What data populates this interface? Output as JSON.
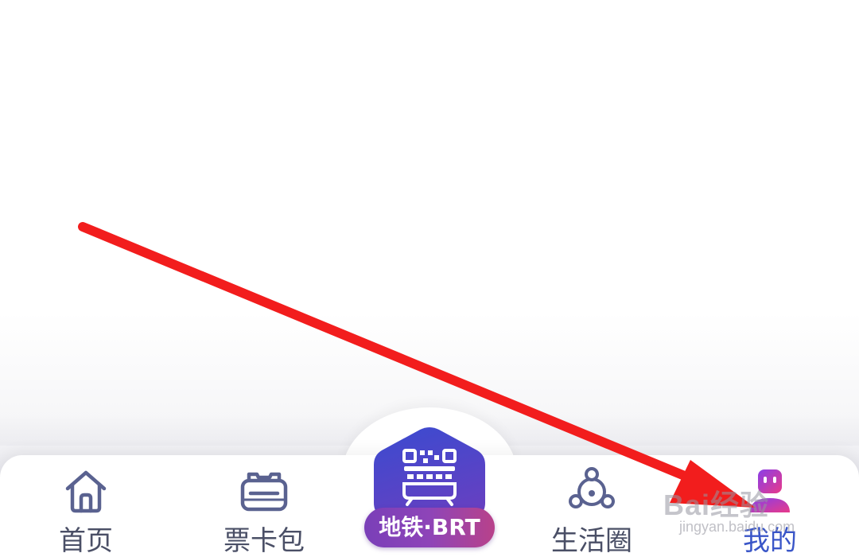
{
  "tabbar": {
    "items": [
      {
        "id": "home",
        "label": "首页",
        "icon": "home-icon",
        "active": false
      },
      {
        "id": "tickets",
        "label": "票卡包",
        "icon": "ticket-wallet-icon",
        "active": false
      },
      {
        "id": "life",
        "label": "生活圈",
        "icon": "life-circle-icon",
        "active": false
      },
      {
        "id": "mine",
        "label": "我的",
        "icon": "profile-icon",
        "active": true
      }
    ],
    "center": {
      "label": "地铁·BRT",
      "icon": "qr-train-icon"
    }
  },
  "colors": {
    "accent": "#3a56c8",
    "tab_text": "#4a4f66",
    "center_gradient_start": "#3a4bd0",
    "center_gradient_end": "#7a3fb8",
    "arrow": "#f21d1d"
  },
  "watermark": {
    "brand": "Bai经验",
    "url": "jingyan.baidu.com"
  }
}
